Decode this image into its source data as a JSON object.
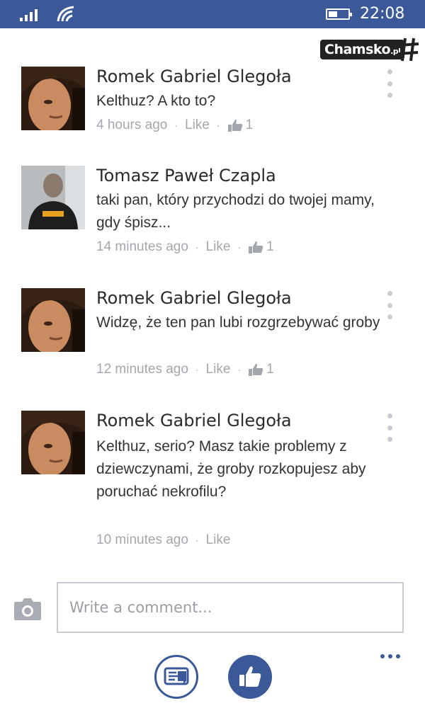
{
  "status_bar": {
    "time": "22:08"
  },
  "watermark": {
    "text": "Chamsko",
    "suffix": ".pl"
  },
  "comments": [
    {
      "author": "Romek Gabriel Glegoła",
      "text": "Kelthuz? A kto to?",
      "time": "4 hours ago",
      "like_label": "Like",
      "likes": "1",
      "avatar": "young-man-portrait"
    },
    {
      "author": "Tomasz Paweł Czapla",
      "text": "taki pan, który przychodzi do twojej mamy, gdy śpisz...",
      "time": "14 minutes ago",
      "like_label": "Like",
      "likes": "1",
      "avatar": "man-in-tshirt-photo"
    },
    {
      "author": "Romek Gabriel Glegoła",
      "text": "Widzę, że ten pan lubi rozgrzebywać groby",
      "time": "12 minutes ago",
      "like_label": "Like",
      "likes": "1",
      "avatar": "young-man-portrait"
    },
    {
      "author": "Romek Gabriel Glegoła",
      "text": "Kelthuz, serio? Masz takie problemy z dziewczynami, że groby rozkopujesz aby poruchać nekrofilu?",
      "time": "10 minutes ago",
      "like_label": "Like",
      "likes": "",
      "avatar": "young-man-portrait"
    }
  ],
  "composer": {
    "placeholder": "Write a comment..."
  },
  "colors": {
    "brand": "#3b5998",
    "meta": "#a3a7ae",
    "border": "#c8ccd3"
  },
  "icons": {
    "camera": "camera-icon",
    "more": "more-icon",
    "comments": "comments-icon",
    "like": "thumbs-up-icon"
  }
}
